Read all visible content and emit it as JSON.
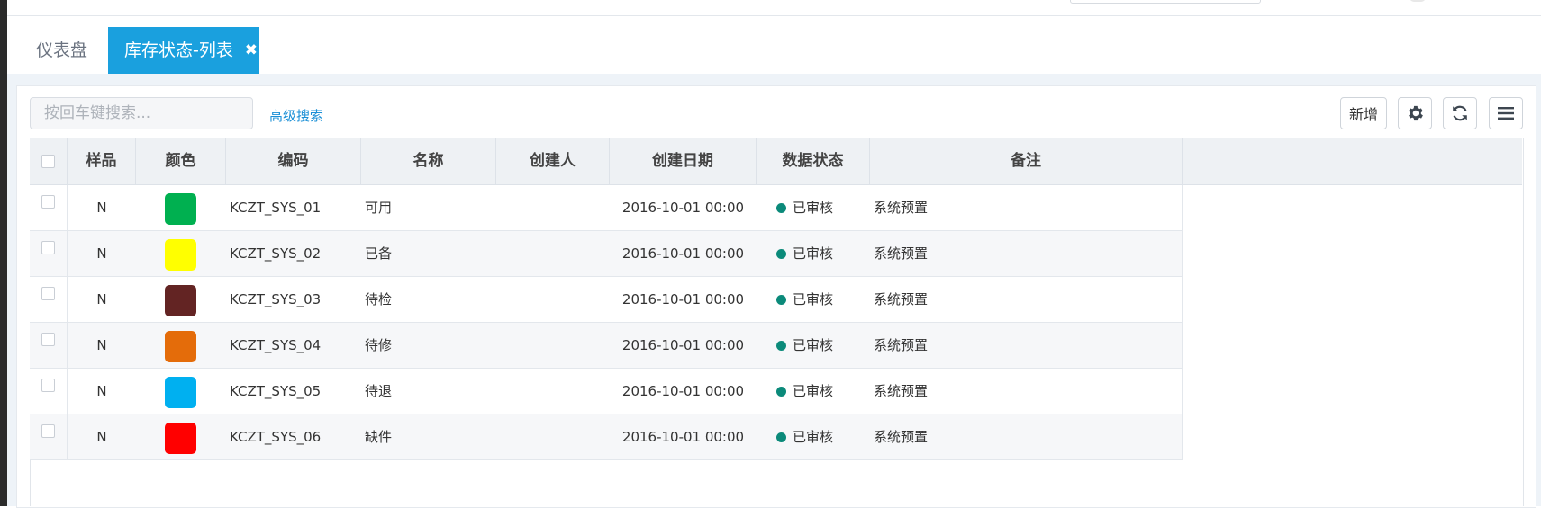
{
  "tabs": [
    {
      "label": "仪表盘"
    },
    {
      "label": "库存状态-列表",
      "close_icon": "✖"
    }
  ],
  "toolbar": {
    "search_placeholder": "按回车键搜索...",
    "advanced_search": "高级搜索",
    "add_label": "新增",
    "settings_icon": "gear-icon",
    "refresh_icon": "refresh-icon",
    "menu_icon": "menu-icon"
  },
  "table": {
    "columns": [
      "样品",
      "颜色",
      "编码",
      "名称",
      "创建人",
      "创建日期",
      "数据状态",
      "备注"
    ],
    "rows": [
      {
        "sample": "N",
        "color": "#00b050",
        "code": "KCZT_SYS_01",
        "name": "可用",
        "creator": "",
        "created": "2016-10-01 00:00",
        "status": "已审核",
        "remark": "系统预置"
      },
      {
        "sample": "N",
        "color": "#ffff00",
        "code": "KCZT_SYS_02",
        "name": "已备",
        "creator": "",
        "created": "2016-10-01 00:00",
        "status": "已审核",
        "remark": "系统预置"
      },
      {
        "sample": "N",
        "color": "#632423",
        "code": "KCZT_SYS_03",
        "name": "待检",
        "creator": "",
        "created": "2016-10-01 00:00",
        "status": "已审核",
        "remark": "系统预置"
      },
      {
        "sample": "N",
        "color": "#e46c0a",
        "code": "KCZT_SYS_04",
        "name": "待修",
        "creator": "",
        "created": "2016-10-01 00:00",
        "status": "已审核",
        "remark": "系统预置"
      },
      {
        "sample": "N",
        "color": "#00b0f0",
        "code": "KCZT_SYS_05",
        "name": "待退",
        "creator": "",
        "created": "2016-10-01 00:00",
        "status": "已审核",
        "remark": "系统预置"
      },
      {
        "sample": "N",
        "color": "#ff0000",
        "code": "KCZT_SYS_06",
        "name": "缺件",
        "creator": "",
        "created": "2016-10-01 00:00",
        "status": "已审核",
        "remark": "系统预置"
      }
    ]
  },
  "colors": {
    "accent": "#1aa0de",
    "link": "#1a8fd6",
    "status_approved": "#0b8a7a"
  }
}
